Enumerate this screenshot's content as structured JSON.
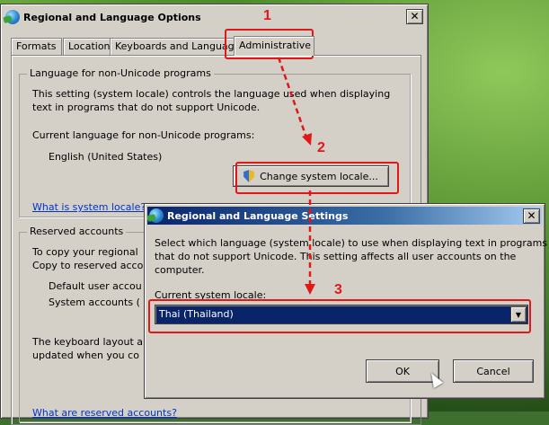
{
  "main_window": {
    "title": "Regional and Language Options",
    "close": "✕",
    "tabs": [
      "Formats",
      "Location",
      "Keyboards and Languages",
      "Administrative"
    ],
    "non_unicode_group": {
      "label": "Language for non-Unicode programs",
      "desc1": "This setting (system locale) controls the language used when displaying",
      "desc2": "text in programs that do not support Unicode.",
      "current_label": "Current language for non-Unicode programs:",
      "current_value": "English (United States)",
      "change_button": "Change system locale...",
      "link": "What is system locale?"
    },
    "reserved_group": {
      "label": "Reserved accounts",
      "line1": "To copy your regional",
      "line2": "Copy to reserved accou",
      "line3": "Default user accou",
      "line4": "System accounts (",
      "line5": "The keyboard layout a",
      "line6": "updated when you co",
      "link": "What are reserved accounts?"
    }
  },
  "dialog": {
    "title": "Regional and Language Settings",
    "close": "✕",
    "desc1": "Select which language (system locale) to use when displaying text in programs",
    "desc2": "that do not support Unicode. This setting affects all user accounts on the",
    "desc3": "computer.",
    "locale_label": "Current system locale:",
    "locale_value": "Thai (Thailand)",
    "ok": "OK",
    "cancel": "Cancel"
  },
  "annotations": {
    "step1": "1",
    "step2": "2",
    "step3": "3",
    "color": "#e01818"
  }
}
